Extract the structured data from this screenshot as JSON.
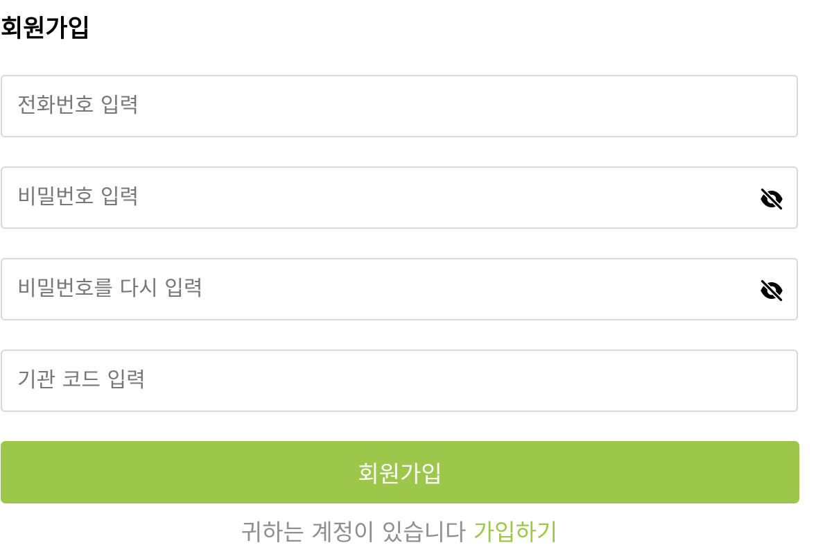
{
  "page": {
    "title": "회원가입"
  },
  "form": {
    "phone_placeholder": "전화번호 입력",
    "password_placeholder": "비밀번호 입력",
    "password_confirm_placeholder": "비밀번호를 다시 입력",
    "org_code_placeholder": "기관 코드 입력",
    "password_visibility_icon": "eye-off-icon",
    "submit_label": "회원가입"
  },
  "footer": {
    "text": "귀하는 계정이 있습니다",
    "link_label": "가입하기"
  },
  "colors": {
    "accent": "#9dc74a",
    "border": "#d9d9d9",
    "placeholder": "#777777",
    "muted_text": "#8f8f8f"
  }
}
